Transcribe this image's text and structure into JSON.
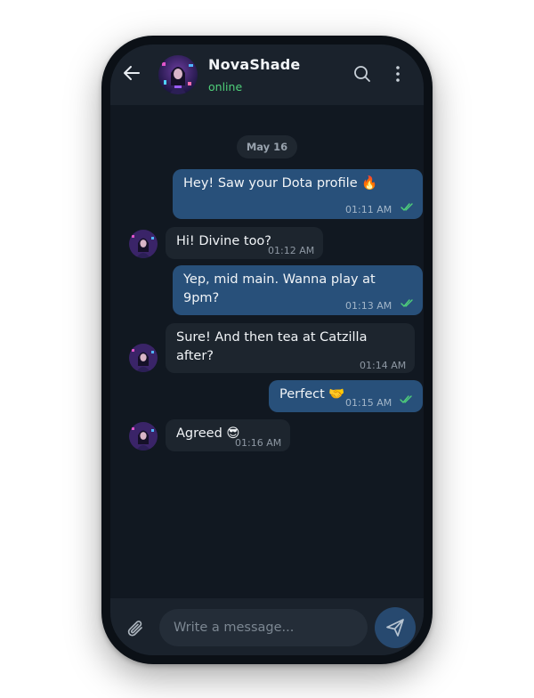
{
  "header": {
    "contact_name": "NovaShade",
    "status": "online"
  },
  "icons": {
    "back": "back-arrow-icon",
    "search": "search-icon",
    "more": "more-vertical-icon",
    "attach": "paperclip-icon",
    "send": "send-icon",
    "read": "double-check-icon"
  },
  "date_divider": "May 16",
  "messages": [
    {
      "direction": "out",
      "lines": [
        "Hey! Saw your Dota profile 🔥"
      ],
      "time": "01:11 AM",
      "read": true
    },
    {
      "direction": "in",
      "lines": [
        "Hi! Divine too?"
      ],
      "time": "01:12 AM"
    },
    {
      "direction": "out",
      "lines": [
        "Yep, mid main. Wanna play at",
        "9pm?"
      ],
      "time": "01:13 AM",
      "read": true
    },
    {
      "direction": "in",
      "lines": [
        "Sure! And then tea at Catzilla",
        "after?"
      ],
      "time": "01:14 AM"
    },
    {
      "direction": "out",
      "lines": [
        "Perfect 🤝"
      ],
      "time": "01:15 AM",
      "read": true
    },
    {
      "direction": "in",
      "lines": [
        "Agreed 😎"
      ],
      "time": "01:16 AM"
    }
  ],
  "composer": {
    "placeholder": "Write a message..."
  },
  "colors": {
    "outgoing_bubble": "#28507a",
    "incoming_bubble": "#1d252e",
    "online": "#4fd07a",
    "read_tick": "#4fd07a"
  }
}
